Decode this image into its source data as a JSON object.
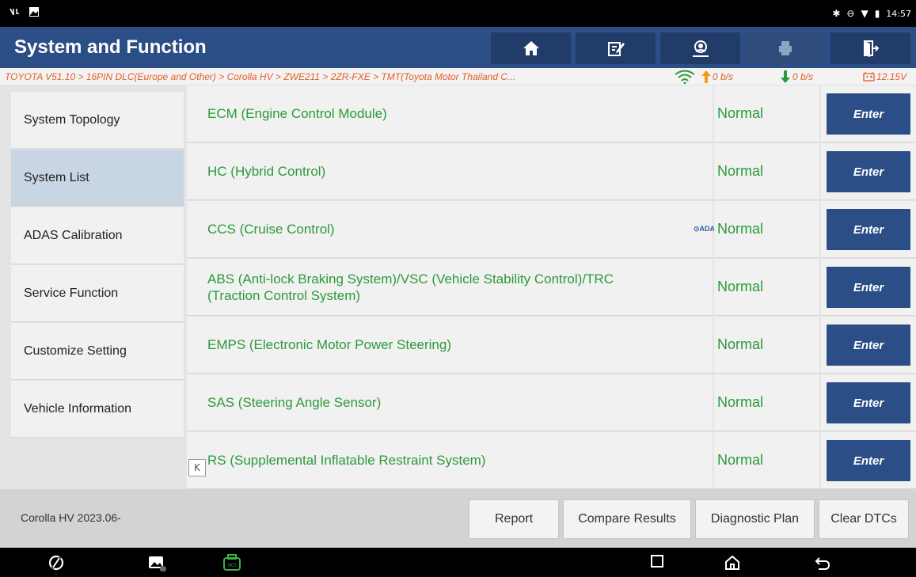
{
  "status_bar": {
    "time": "14:57"
  },
  "header": {
    "title": "System and Function"
  },
  "breadcrumb": {
    "path": "TOYOTA V51.10 > 16PIN DLC(Europe and Other) > Corolla HV > ZWE211 > 2ZR-FXE > TMT(Toyota Motor Thailand C...",
    "upload_rate": "0 b/s",
    "download_rate": "0 b/s",
    "battery_voltage": "12.15V"
  },
  "sidebar": {
    "items": [
      {
        "label": "System Topology"
      },
      {
        "label": "System List"
      },
      {
        "label": "ADAS Calibration"
      },
      {
        "label": "Service Function"
      },
      {
        "label": "Customize Setting"
      },
      {
        "label": "Vehicle Information"
      }
    ]
  },
  "systems": [
    {
      "name": "ECM (Engine Control Module)",
      "status": "Normal",
      "button": "Enter"
    },
    {
      "name": "HC (Hybrid Control)",
      "status": "Normal",
      "button": "Enter"
    },
    {
      "name": "CCS (Cruise Control)",
      "status": "Normal",
      "button": "Enter",
      "badge": "⊙ADAS"
    },
    {
      "name": "ABS (Anti-lock Braking System)/VSC (Vehicle Stability Control)/TRC (Traction Control System)",
      "status": "Normal",
      "button": "Enter"
    },
    {
      "name": "EMPS (Electronic Motor Power Steering)",
      "status": "Normal",
      "button": "Enter"
    },
    {
      "name": "SAS (Steering Angle Sensor)",
      "status": "Normal",
      "button": "Enter"
    },
    {
      "name": "RS (Supplemental Inflatable Restraint System)",
      "status": "Normal",
      "button": "Enter"
    }
  ],
  "collapse_label": "K",
  "footer": {
    "vehicle": "Corolla HV 2023.06-",
    "report": "Report",
    "compare": "Compare Results",
    "plan": "Diagnostic Plan",
    "clear": "Clear DTCs"
  },
  "colors": {
    "header": "#2c4e86",
    "accent_green": "#2c9a3a",
    "breadcrumb_orange": "#e35f27"
  }
}
